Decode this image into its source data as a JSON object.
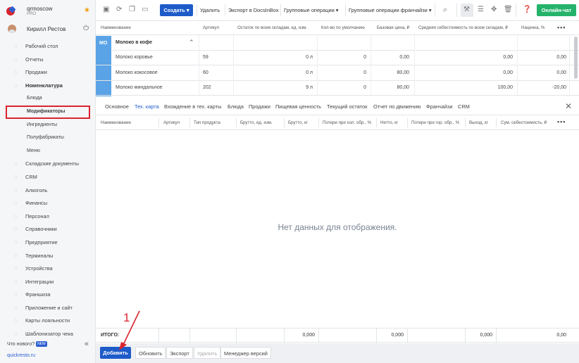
{
  "brand": {
    "name": "qrmoscow",
    "plan": "PRO"
  },
  "user": {
    "name": "Кирилл Рестов"
  },
  "nav": [
    {
      "label": "Рабочий стол",
      "icon": "dashboard-icon",
      "type": "main"
    },
    {
      "label": "Отчеты",
      "icon": "reports-icon",
      "type": "main"
    },
    {
      "label": "Продажи",
      "icon": "sales-icon",
      "type": "main"
    },
    {
      "label": "Номенклатура",
      "icon": "tag-icon",
      "type": "bold"
    },
    {
      "label": "Блюда",
      "type": "sub"
    },
    {
      "label": "Модификаторы",
      "type": "active"
    },
    {
      "label": "Ингредиенты",
      "type": "sub"
    },
    {
      "label": "Полуфабрикаты",
      "type": "sub"
    },
    {
      "label": "Меню",
      "type": "sub"
    },
    {
      "label": "Складские документы",
      "icon": "documents-icon",
      "type": "main"
    },
    {
      "label": "CRM",
      "icon": "crm-icon",
      "type": "main"
    },
    {
      "label": "Алкоголь",
      "icon": "glass-icon",
      "type": "main"
    },
    {
      "label": "Финансы",
      "icon": "finance-icon",
      "type": "main"
    },
    {
      "label": "Персонал",
      "icon": "staff-icon",
      "type": "main"
    },
    {
      "label": "Справочники",
      "icon": "book-icon",
      "type": "main"
    },
    {
      "label": "Предприятие",
      "icon": "building-icon",
      "type": "main"
    },
    {
      "label": "Терминалы",
      "icon": "terminal-icon",
      "type": "main"
    },
    {
      "label": "Устройства",
      "icon": "device-icon",
      "type": "main"
    },
    {
      "label": "Интеграции",
      "icon": "integration-icon",
      "type": "main"
    },
    {
      "label": "Франшиза",
      "icon": "franchise-icon",
      "type": "main"
    },
    {
      "label": "Приложение и сайт",
      "icon": "app-icon",
      "type": "main"
    },
    {
      "label": "Карты лояльности",
      "icon": "card-icon",
      "type": "main"
    },
    {
      "label": "Шаблонизатор чека",
      "icon": "receipt-icon",
      "type": "main"
    }
  ],
  "sidebar_footer": {
    "whats_new": "Что нового?",
    "new_badge": "NEW",
    "site": "quickresto.ru"
  },
  "toolbar": {
    "create": "Создать ▾",
    "delete": "Удалить",
    "export_docsinbox": "Экспорт в DocsInBox",
    "group_ops": "Групповые операции ▾",
    "group_ops_franchise": "Групповые операции франчайзи ▾",
    "online_chat": "Онлайн-чат"
  },
  "grid1": {
    "headers": [
      "Наименование",
      "Артикул",
      "Остаток по всем складам, ед. изм.",
      "Кол-во по умолчанию",
      "Базовая цена, ₽",
      "Средняя себестоимость по всем складам, ₽",
      "Наценка, %"
    ],
    "group": {
      "badge": "МО",
      "name": "Молоко в кофе"
    },
    "rows": [
      {
        "name": "Молоко коровье",
        "article": "59",
        "stock": "0 л",
        "qty": "0",
        "price": "0,00",
        "cost": "0,00",
        "markup": "0,00"
      },
      {
        "name": "Молоко кокосовое",
        "article": "60",
        "stock": "0 л",
        "qty": "0",
        "price": "80,00",
        "cost": "0,00",
        "markup": "0,00"
      },
      {
        "name": "Молоко миндальное",
        "article": "202",
        "stock": "9 л",
        "qty": "0",
        "price": "80,00",
        "cost": "100,00",
        "markup": "-20,00"
      }
    ]
  },
  "tabs": [
    "Основное",
    "Тех. карта",
    "Вхождение в тех. карты",
    "Блюда",
    "Продажи",
    "Пищевая ценность",
    "Текущий остаток",
    "Отчет по движению",
    "Франчайзи",
    "CRM"
  ],
  "grid2": {
    "headers": [
      "Наименование",
      "Артикул",
      "Тип продукта",
      "Брутто, ед. изм.",
      "Брутто, кг",
      "Потери при хол. обр., %",
      "Нетто, кг",
      "Потери при гор. обр., %",
      "Выход, кг",
      "Сум. себестоимость, ₽"
    ],
    "empty_text": "Нет данных для отображения.",
    "totals_label": "ИТОГО:",
    "totals": [
      "0,000",
      "0,000",
      "0,000",
      "0,00"
    ]
  },
  "bottom": {
    "add": "Добавить",
    "refresh": "Обновить",
    "export": "Экспорт",
    "delete": "Удалить",
    "versions": "Менеджер версий"
  },
  "annotation": {
    "number": "1"
  },
  "colors": {
    "primary": "#1d5bc9",
    "chat": "#25b36b",
    "highlight": "#d9252f",
    "group_bar": "#5aa3e6"
  }
}
